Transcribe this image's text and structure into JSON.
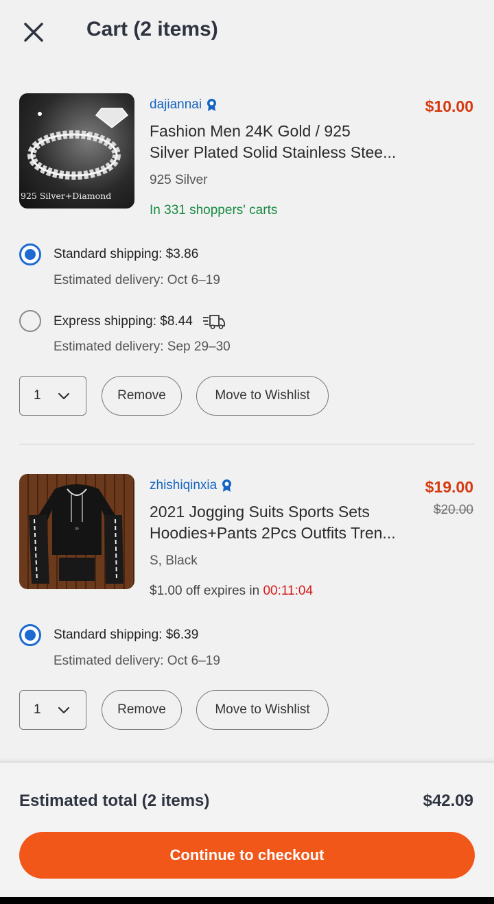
{
  "header": {
    "title": "Cart (2 items)"
  },
  "items": [
    {
      "seller": "dajiannai",
      "price": "$10.00",
      "title_line1": "Fashion Men 24K Gold / 925",
      "title_line2": "Silver Plated Solid Stainless Stee...",
      "variant": "925 Silver",
      "popularity": "In 331 shoppers' carts",
      "thumb_caption": "925 Silver+Diamond",
      "shipping_options": [
        {
          "label": "Standard shipping: $3.86",
          "estimate": "Estimated delivery: Oct 6–19",
          "selected": true
        },
        {
          "label": "Express shipping: $8.44",
          "estimate": "Estimated delivery: Sep 29–30",
          "selected": false,
          "icon": "fast-truck-icon"
        }
      ],
      "quantity": "1",
      "remove_label": "Remove",
      "wishlist_label": "Move to Wishlist"
    },
    {
      "seller": "zhishiqinxia",
      "price": "$19.00",
      "original_price": "$20.00",
      "title_line1": "2021 Jogging Suits Sports Sets",
      "title_line2": "Hoodies+Pants 2Pcs Outfits Tren...",
      "variant": "S, Black",
      "promo_text": "$1.00 off expires in ",
      "promo_timer": "00:11:04",
      "shipping_options": [
        {
          "label": "Standard shipping: $6.39",
          "estimate": "Estimated delivery: Oct 6–19",
          "selected": true
        }
      ],
      "quantity": "1",
      "remove_label": "Remove",
      "wishlist_label": "Move to Wishlist"
    }
  ],
  "footer": {
    "total_label": "Estimated total (2 items)",
    "total_value": "$42.09",
    "checkout_label": "Continue to checkout"
  },
  "colors": {
    "accent": "#f2571a",
    "price": "#d6380f",
    "link": "#1665c0",
    "radio": "#1d6ad1",
    "popularity": "#178a42",
    "timer": "#d61b1b"
  }
}
